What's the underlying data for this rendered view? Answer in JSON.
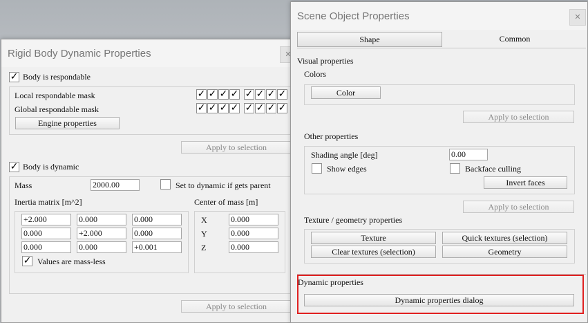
{
  "rigid": {
    "title": "Rigid Body Dynamic Properties",
    "close": "✕",
    "respondable": {
      "checked": "✓",
      "label": "Body is respondable",
      "local_mask_label": "Local respondable mask",
      "global_mask_label": "Global respondable mask",
      "local_mask": [
        "✓",
        "✓",
        "✓",
        "✓",
        "✓",
        "✓",
        "✓",
        "✓"
      ],
      "global_mask": [
        "✓",
        "✓",
        "✓",
        "✓",
        "✓",
        "✓",
        "✓",
        "✓"
      ],
      "engine_button": "Engine properties",
      "apply_button": "Apply to selection"
    },
    "dynamic": {
      "checked": "✓",
      "label": "Body is dynamic",
      "mass_label": "Mass",
      "mass_value": "2000.00",
      "set_dynamic_label": "Set to dynamic if gets parent",
      "set_dynamic_checked": "",
      "inertia_label": "Inertia matrix [m^2]",
      "inertia": [
        [
          "+2.000",
          "0.000",
          "0.000"
        ],
        [
          "0.000",
          "+2.000",
          "0.000"
        ],
        [
          "0.000",
          "0.000",
          "+0.001"
        ]
      ],
      "massless_checked": "✓",
      "massless_label": "Values are mass-less",
      "com_label": "Center of mass [m]",
      "com": [
        {
          "axis": "X",
          "value": "0.000"
        },
        {
          "axis": "Y",
          "value": "0.000"
        },
        {
          "axis": "Z",
          "value": "0.000"
        }
      ],
      "apply_button": "Apply to selection"
    }
  },
  "scene": {
    "title": "Scene Object Properties",
    "close": "✕",
    "tabs": [
      "Shape",
      "Common"
    ],
    "visual_label": "Visual properties",
    "colors_label": "Colors",
    "color_button": "Color",
    "apply_button_1": "Apply to selection",
    "other_label": "Other properties",
    "shading_label": "Shading angle [deg]",
    "shading_value": "0.00",
    "show_edges_label": "Show edges",
    "show_edges_checked": "",
    "backface_label": "Backface culling",
    "backface_checked": "",
    "invert_faces_button": "Invert faces",
    "apply_button_2": "Apply to selection",
    "texture_label": "Texture / geometry properties",
    "texture_button": "Texture",
    "quick_textures_button": "Quick textures (selection)",
    "clear_textures_button": "Clear textures (selection)",
    "geometry_button": "Geometry",
    "dynamic_label": "Dynamic properties",
    "dynamic_button": "Dynamic properties dialog"
  },
  "colors": {
    "highlight": "#e02020"
  }
}
